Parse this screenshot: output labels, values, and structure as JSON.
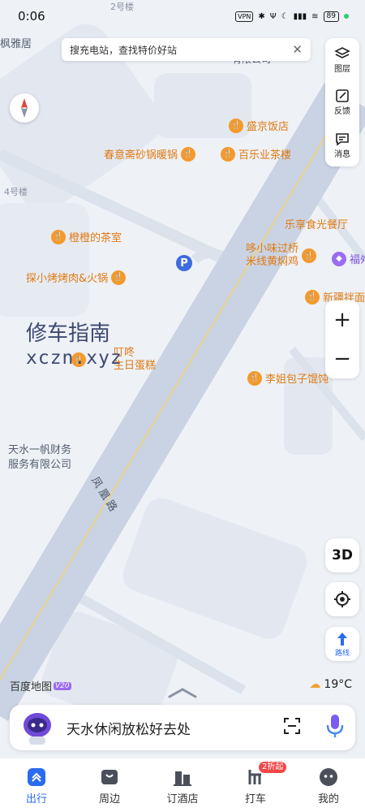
{
  "status_bar": {
    "time": "0:06",
    "vpn": "VPN",
    "battery": "89"
  },
  "search_bar": {
    "text": "搜充电站，查找特价好站",
    "close": "✕"
  },
  "side_panel": {
    "layers": "图层",
    "feedback": "反馈",
    "messages": "消息"
  },
  "zoom": {
    "in": "+",
    "out": "−"
  },
  "buttons": {
    "three_d": "3D",
    "route": "路线"
  },
  "map": {
    "buildings": [
      "2号楼",
      "4号楼"
    ],
    "place_labels": {
      "fengyaju": "枫雅居",
      "partial_company": "有限公司",
      "company_line1": "天水一帆财务",
      "company_line2": "服务有限公司",
      "partial_fuwu": "福ﾀ"
    },
    "road": "凤凰路",
    "pois": [
      {
        "id": "shengjing",
        "name": "盛京饭店"
      },
      {
        "id": "chunyi",
        "name": "春意斋砂锅暖锅"
      },
      {
        "id": "bailey",
        "name": "百乐业茶楼"
      },
      {
        "id": "chengcheng",
        "name": "橙橙的茶室"
      },
      {
        "id": "tanxiao",
        "name": "探小烤烤肉&火锅"
      },
      {
        "id": "lexiang",
        "name": "乐享食光餐厅"
      },
      {
        "id": "duoxiaowei1",
        "name": "哆小味过桥"
      },
      {
        "id": "duoxiaowei2",
        "name": "米线黄焖鸡"
      },
      {
        "id": "xinjiang",
        "name": "新疆拌面"
      },
      {
        "id": "cake1",
        "name": "叮咚"
      },
      {
        "id": "cake2",
        "name": "生日蛋糕"
      },
      {
        "id": "lijie",
        "name": "李姐包子馄饨"
      }
    ]
  },
  "watermark": {
    "line1": "修车指南",
    "line2": "xczn.xyz"
  },
  "logo": {
    "text": "百度地图",
    "version": "V20"
  },
  "weather": {
    "temp": "19°C"
  },
  "query_bar": {
    "text": "天水休闲放松好去处"
  },
  "tabs": [
    {
      "label": "出行"
    },
    {
      "label": "周边"
    },
    {
      "label": "订酒店"
    },
    {
      "label": "打车",
      "badge": "2折起"
    },
    {
      "label": "我的"
    }
  ],
  "colors": {
    "accent": "#2a6cf0",
    "poi": "#f49a2c",
    "map_bg": "#eef1f6",
    "road": "#c9d3e3",
    "road_center": "#e9d28a"
  }
}
